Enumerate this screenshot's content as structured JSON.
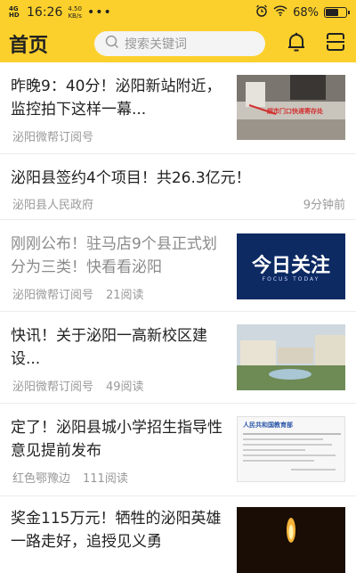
{
  "status": {
    "network": "4G HD",
    "time": "16:26",
    "speed_value": "4.50",
    "speed_unit": "KB/s",
    "dots": "•••",
    "battery_pct": "68%",
    "battery_level": 0.68
  },
  "header": {
    "title": "首页",
    "search_placeholder": "搜索关键词"
  },
  "articles": [
    {
      "title": "昨晚9：40分！泌阳新站附近，监控拍下这样一幕...",
      "source": "泌阳微帮订阅号",
      "reads": "",
      "time": "",
      "read": false,
      "thumb_caption": "超市门口快递寄存处"
    },
    {
      "title": "泌阳县签约4个项目！共26.3亿元！",
      "source": "泌阳县人民政府",
      "reads": "",
      "time": "9分钟前",
      "read": false
    },
    {
      "title": "刚刚公布！驻马店9个县正式划分为三类！快看看泌阳",
      "source": "泌阳微帮订阅号",
      "reads": "21阅读",
      "time": "",
      "read": true,
      "thumb_caption": "今日关注",
      "thumb_sub": "FOCUS TODAY"
    },
    {
      "title": "快讯！关于泌阳一高新校区建设...",
      "source": "泌阳微帮订阅号",
      "reads": "49阅读",
      "time": "",
      "read": false
    },
    {
      "title": "定了！泌阳县城小学招生指导性意见提前发布",
      "source": "红色鄂豫边",
      "reads": "111阅读",
      "time": "",
      "read": false,
      "thumb_caption": "人民共和国教育部"
    },
    {
      "title": "奖金115万元！牺牲的泌阳英雄一路走好，追授见义勇",
      "source": "",
      "reads": "",
      "time": "",
      "read": false
    }
  ]
}
